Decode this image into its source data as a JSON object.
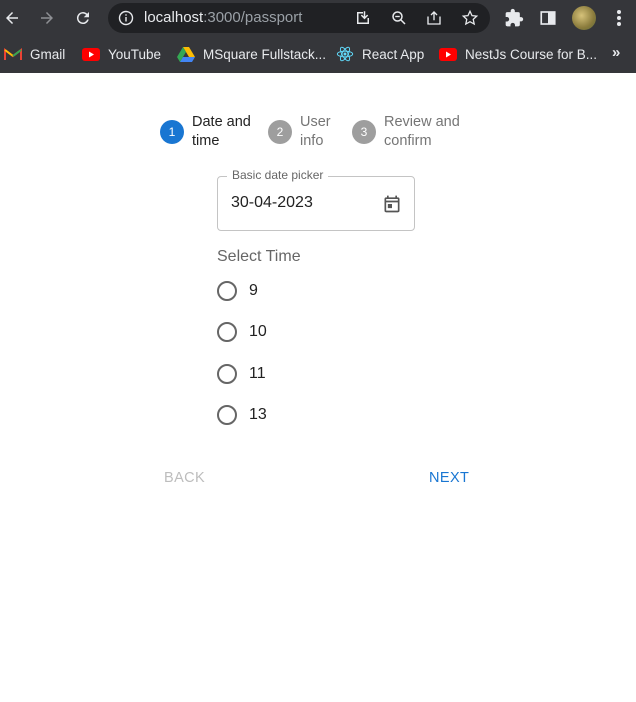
{
  "browser": {
    "url_host": "localhost",
    "url_path": ":3000/passport",
    "bookmarks": [
      {
        "label": "Gmail",
        "icon": "gmail-icon"
      },
      {
        "label": "YouTube",
        "icon": "youtube-icon"
      },
      {
        "label": "MSquare Fullstack...",
        "icon": "google-drive-icon"
      },
      {
        "label": "React App",
        "icon": "react-icon"
      },
      {
        "label": "NestJs Course for B...",
        "icon": "youtube-icon"
      }
    ],
    "more": "»"
  },
  "stepper": {
    "steps": [
      {
        "number": "1",
        "line1": "Date and",
        "line2": "time",
        "active": true
      },
      {
        "number": "2",
        "line1": "User",
        "line2": "info",
        "active": false
      },
      {
        "number": "3",
        "line1": "Review and",
        "line2": "confirm",
        "active": false
      }
    ]
  },
  "date_picker": {
    "label": "Basic date picker",
    "value": "30-04-2023"
  },
  "time": {
    "label": "Select Time",
    "options": [
      "9",
      "10",
      "11",
      "13"
    ],
    "selected": null
  },
  "actions": {
    "back": "BACK",
    "next": "NEXT"
  },
  "colors": {
    "primary": "#1976d2",
    "inactive_step": "#9e9e9e",
    "chrome_bg": "#35363a",
    "omnibox_bg": "#202124"
  }
}
